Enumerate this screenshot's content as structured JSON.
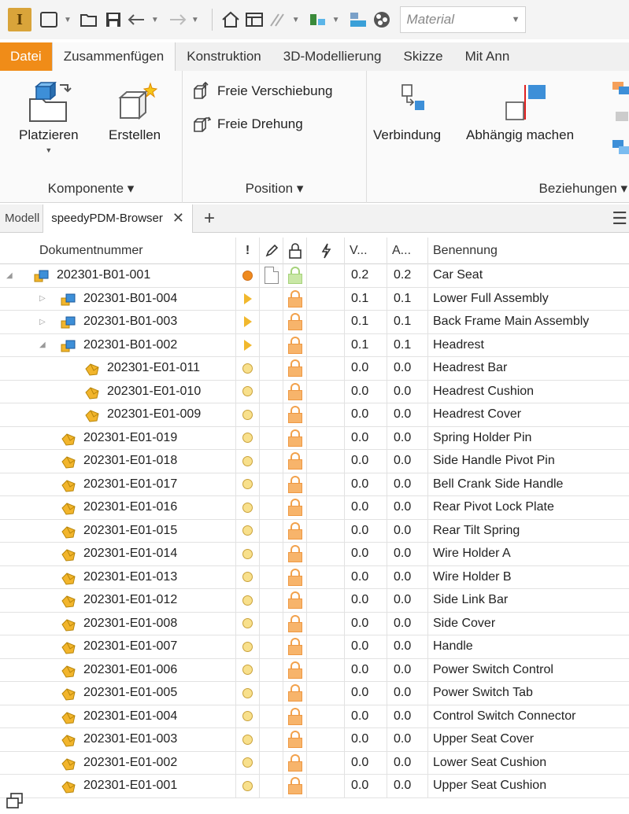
{
  "app": {
    "logo_letter": "I",
    "material_label": "Material",
    "accent_color": "#f08c18"
  },
  "ribbon_tabs": [
    "Datei",
    "Zusammenfügen",
    "Konstruktion",
    "3D-Modellierung",
    "Skizze",
    "Mit Ann"
  ],
  "ribbon": {
    "komponente": {
      "group_label": "Komponente ▾",
      "platzieren": "Platzieren",
      "erstellen": "Erstellen"
    },
    "position": {
      "group_label": "Position ▾",
      "freie_verschiebung": "Freie Verschiebung",
      "freie_drehung": "Freie Drehung"
    },
    "beziehungen": {
      "group_label": "Beziehungen ▾",
      "verbindung": "Verbindung",
      "abhaengig": "Abhängig machen"
    }
  },
  "browser": {
    "model_tab": "Modell",
    "active_tab": "speedyPDM-Browser",
    "close_glyph": "✕",
    "add_glyph": "+",
    "menu_glyph": "☰"
  },
  "grid": {
    "headers": {
      "docnum": "Dokumentnummer",
      "flag": "!",
      "v": "V...",
      "a": "A...",
      "name": "Benennung"
    },
    "rows": [
      {
        "num": "202301-B01-001",
        "level": 0,
        "kind": "assembly",
        "expander": "◢",
        "status": "dot-filled",
        "doc": true,
        "lock": "green",
        "v": "0.2",
        "a": "0.2",
        "name": "Car Seat"
      },
      {
        "num": "202301-B01-004",
        "level": 1,
        "kind": "assembly",
        "expander": "▷",
        "status": "tri",
        "doc": false,
        "lock": "orange",
        "v": "0.1",
        "a": "0.1",
        "name": "Lower Full Assembly"
      },
      {
        "num": "202301-B01-003",
        "level": 1,
        "kind": "assembly",
        "expander": "▷",
        "status": "tri",
        "doc": false,
        "lock": "orange",
        "v": "0.1",
        "a": "0.1",
        "name": "Back Frame Main Assembly"
      },
      {
        "num": "202301-B01-002",
        "level": 1,
        "kind": "assembly",
        "expander": "◢",
        "status": "tri",
        "doc": false,
        "lock": "orange",
        "v": "0.1",
        "a": "0.1",
        "name": "Headrest"
      },
      {
        "num": "202301-E01-011",
        "level": 2,
        "kind": "part",
        "expander": "",
        "status": "dot",
        "doc": false,
        "lock": "orange",
        "v": "0.0",
        "a": "0.0",
        "name": "Headrest Bar"
      },
      {
        "num": "202301-E01-010",
        "level": 2,
        "kind": "part",
        "expander": "",
        "status": "dot",
        "doc": false,
        "lock": "orange",
        "v": "0.0",
        "a": "0.0",
        "name": "Headrest Cushion"
      },
      {
        "num": "202301-E01-009",
        "level": 2,
        "kind": "part",
        "expander": "",
        "status": "dot",
        "doc": false,
        "lock": "orange",
        "v": "0.0",
        "a": "0.0",
        "name": "Headrest Cover"
      },
      {
        "num": "202301-E01-019",
        "level": 1,
        "kind": "part",
        "expander": "",
        "status": "dot",
        "doc": false,
        "lock": "orange",
        "v": "0.0",
        "a": "0.0",
        "name": "Spring Holder Pin"
      },
      {
        "num": "202301-E01-018",
        "level": 1,
        "kind": "part",
        "expander": "",
        "status": "dot",
        "doc": false,
        "lock": "orange",
        "v": "0.0",
        "a": "0.0",
        "name": "Side Handle Pivot Pin"
      },
      {
        "num": "202301-E01-017",
        "level": 1,
        "kind": "part",
        "expander": "",
        "status": "dot",
        "doc": false,
        "lock": "orange",
        "v": "0.0",
        "a": "0.0",
        "name": "Bell Crank Side Handle"
      },
      {
        "num": "202301-E01-016",
        "level": 1,
        "kind": "part",
        "expander": "",
        "status": "dot",
        "doc": false,
        "lock": "orange",
        "v": "0.0",
        "a": "0.0",
        "name": "Rear Pivot Lock Plate"
      },
      {
        "num": "202301-E01-015",
        "level": 1,
        "kind": "part",
        "expander": "",
        "status": "dot",
        "doc": false,
        "lock": "orange",
        "v": "0.0",
        "a": "0.0",
        "name": "Rear Tilt Spring"
      },
      {
        "num": "202301-E01-014",
        "level": 1,
        "kind": "part",
        "expander": "",
        "status": "dot",
        "doc": false,
        "lock": "orange",
        "v": "0.0",
        "a": "0.0",
        "name": "Wire Holder A"
      },
      {
        "num": "202301-E01-013",
        "level": 1,
        "kind": "part",
        "expander": "",
        "status": "dot",
        "doc": false,
        "lock": "orange",
        "v": "0.0",
        "a": "0.0",
        "name": "Wire Holder B"
      },
      {
        "num": "202301-E01-012",
        "level": 1,
        "kind": "part",
        "expander": "",
        "status": "dot",
        "doc": false,
        "lock": "orange",
        "v": "0.0",
        "a": "0.0",
        "name": "Side Link Bar"
      },
      {
        "num": "202301-E01-008",
        "level": 1,
        "kind": "part",
        "expander": "",
        "status": "dot",
        "doc": false,
        "lock": "orange",
        "v": "0.0",
        "a": "0.0",
        "name": "Side Cover"
      },
      {
        "num": "202301-E01-007",
        "level": 1,
        "kind": "part",
        "expander": "",
        "status": "dot",
        "doc": false,
        "lock": "orange",
        "v": "0.0",
        "a": "0.0",
        "name": "Handle"
      },
      {
        "num": "202301-E01-006",
        "level": 1,
        "kind": "part",
        "expander": "",
        "status": "dot",
        "doc": false,
        "lock": "orange",
        "v": "0.0",
        "a": "0.0",
        "name": "Power Switch Control"
      },
      {
        "num": "202301-E01-005",
        "level": 1,
        "kind": "part",
        "expander": "",
        "status": "dot",
        "doc": false,
        "lock": "orange",
        "v": "0.0",
        "a": "0.0",
        "name": "Power Switch Tab"
      },
      {
        "num": "202301-E01-004",
        "level": 1,
        "kind": "part",
        "expander": "",
        "status": "dot",
        "doc": false,
        "lock": "orange",
        "v": "0.0",
        "a": "0.0",
        "name": "Control Switch Connector"
      },
      {
        "num": "202301-E01-003",
        "level": 1,
        "kind": "part",
        "expander": "",
        "status": "dot",
        "doc": false,
        "lock": "orange",
        "v": "0.0",
        "a": "0.0",
        "name": "Upper Seat Cover"
      },
      {
        "num": "202301-E01-002",
        "level": 1,
        "kind": "part",
        "expander": "",
        "status": "dot",
        "doc": false,
        "lock": "orange",
        "v": "0.0",
        "a": "0.0",
        "name": "Lower Seat Cushion"
      },
      {
        "num": "202301-E01-001",
        "level": 1,
        "kind": "part",
        "expander": "",
        "status": "dot",
        "doc": false,
        "lock": "orange",
        "v": "0.0",
        "a": "0.0",
        "name": "Upper Seat Cushion"
      }
    ]
  }
}
